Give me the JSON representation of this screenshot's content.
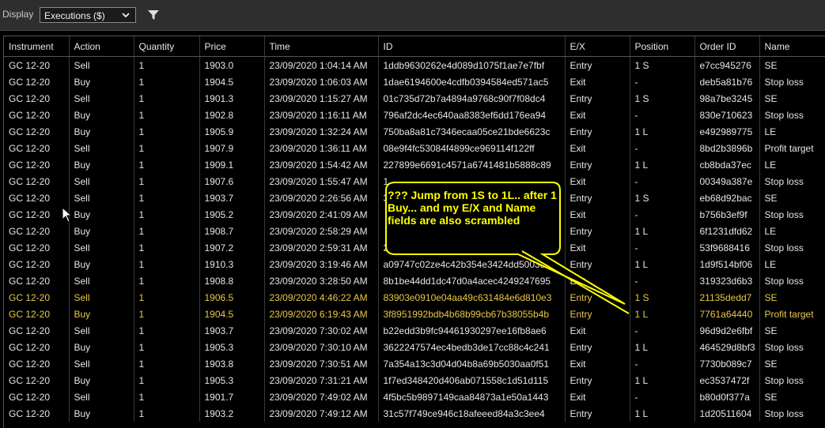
{
  "toolbar": {
    "display_label": "Display",
    "dropdown_value": "Executions ($)",
    "filter_icon": "filter-icon"
  },
  "columns": [
    "Instrument",
    "Action",
    "Quantity",
    "Price",
    "Time",
    "ID",
    "E/X",
    "Position",
    "Order ID",
    "Name"
  ],
  "rows": [
    [
      "GC 12-20",
      "Sell",
      "1",
      "1903.0",
      "23/09/2020 1:04:14 AM",
      "1ddb9630262e4d089d1075f1ae7e7fbf",
      "Entry",
      "1 S",
      "e7cc945276",
      "SE"
    ],
    [
      "GC 12-20",
      "Buy",
      "1",
      "1904.5",
      "23/09/2020 1:06:03 AM",
      "1dae6194600e4cdfb0394584ed571ac5",
      "Exit",
      "-",
      "deb5a81b76",
      "Stop loss"
    ],
    [
      "GC 12-20",
      "Sell",
      "1",
      "1901.3",
      "23/09/2020 1:15:27 AM",
      "01c735d72b7a4894a9768c90f7f08dc4",
      "Entry",
      "1 S",
      "98a7be3245",
      "SE"
    ],
    [
      "GC 12-20",
      "Buy",
      "1",
      "1902.8",
      "23/09/2020 1:16:11 AM",
      "796af2dc4ec640aa8383ef6dd176ea94",
      "Exit",
      "-",
      "830e710623",
      "Stop loss"
    ],
    [
      "GC 12-20",
      "Buy",
      "1",
      "1905.9",
      "23/09/2020 1:32:24 AM",
      "750ba8a81c7346ecaa05ce21bde6623c",
      "Entry",
      "1 L",
      "e492989775",
      "LE"
    ],
    [
      "GC 12-20",
      "Sell",
      "1",
      "1907.9",
      "23/09/2020 1:36:11 AM",
      "08e9f4fc53084f4899ce969114f122ff",
      "Exit",
      "-",
      "8bd2b3896b",
      "Profit target"
    ],
    [
      "GC 12-20",
      "Buy",
      "1",
      "1909.1",
      "23/09/2020 1:54:42 AM",
      "227899e6691c4571a6741481b5888c89",
      "Entry",
      "1 L",
      "cb8bda37ec",
      "LE"
    ],
    [
      "GC 12-20",
      "Sell",
      "1",
      "1907.6",
      "23/09/2020 1:55:47 AM",
      "1",
      "Exit",
      "-",
      "00349a387e",
      "Stop loss"
    ],
    [
      "GC 12-20",
      "Sell",
      "1",
      "1903.7",
      "23/09/2020 2:26:56 AM",
      "3",
      "Entry",
      "1 S",
      "eb68d92bac",
      "SE"
    ],
    [
      "GC 12-20",
      "Buy",
      "1",
      "1905.2",
      "23/09/2020 2:41:09 AM",
      "",
      "Exit",
      "-",
      "b756b3ef9f",
      "Stop loss"
    ],
    [
      "GC 12-20",
      "Buy",
      "1",
      "1908.7",
      "23/09/2020 2:58:29 AM",
      "",
      "Entry",
      "1 L",
      "6f1231dfd62",
      "LE"
    ],
    [
      "GC 12-20",
      "Sell",
      "1",
      "1907.2",
      "23/09/2020 2:59:31 AM",
      "2",
      "Exit",
      "-",
      "53f9688416",
      "Stop loss"
    ],
    [
      "GC 12-20",
      "Buy",
      "1",
      "1910.3",
      "23/09/2020 3:19:46 AM",
      "a09747c02ze4c42b354e3424dd5003d",
      "Entry",
      "1 L",
      "1d9f514bf06",
      "LE"
    ],
    [
      "GC 12-20",
      "Sell",
      "1",
      "1908.8",
      "23/09/2020 3:28:50 AM",
      "8b1be44dd1dc47d0a4acec4249247695",
      "Exit",
      "-",
      "319323d6b3",
      "Stop loss"
    ],
    [
      "GC 12-20",
      "Sell",
      "1",
      "1906.5",
      "23/09/2020 4:46:22 AM",
      "83903e0910e04aa49c631484e6d810e3",
      "Entry",
      "1 S",
      "21135dedd7",
      "SE"
    ],
    [
      "GC 12-20",
      "Buy",
      "1",
      "1904.5",
      "23/09/2020 6:19:43 AM",
      "3f8951992bdb4b68b99cb67b38055b4b",
      "Entry",
      "1 L",
      "7761a64440",
      "Profit target"
    ],
    [
      "GC 12-20",
      "Sell",
      "1",
      "1903.7",
      "23/09/2020 7:30:02 AM",
      "b22edd3b9fc94461930297ee16fb8ae6",
      "Exit",
      "-",
      "96d9d2e6fbf",
      "SE"
    ],
    [
      "GC 12-20",
      "Buy",
      "1",
      "1905.3",
      "23/09/2020 7:30:10 AM",
      "3622247574ec4bedb3de17cc88c4c241",
      "Entry",
      "1 L",
      "464529d8bf3",
      "Stop loss"
    ],
    [
      "GC 12-20",
      "Sell",
      "1",
      "1903.8",
      "23/09/2020 7:30:51 AM",
      "7a354a13c3d04d04b8a69b5030aa0f51",
      "Exit",
      "-",
      "7730b089c7",
      "SE"
    ],
    [
      "GC 12-20",
      "Buy",
      "1",
      "1905.3",
      "23/09/2020 7:31:21 AM",
      "1f7ed348420d406ab071558c1d51d115",
      "Entry",
      "1 L",
      "ec3537472f",
      "Stop loss"
    ],
    [
      "GC 12-20",
      "Sell",
      "1",
      "1901.7",
      "23/09/2020 7:49:02 AM",
      "4f5bc5b9897149caa84873a1e50a1443",
      "Exit",
      "-",
      "b80d0f377a",
      "SE"
    ],
    [
      "GC 12-20",
      "Buy",
      "1",
      "1903.2",
      "23/09/2020 7:49:12 AM",
      "31c57f749ce946c18afeeed84a3c3ee4",
      "Entry",
      "1 L",
      "1d20511604",
      "Stop loss"
    ]
  ],
  "highlighted_rows": [
    14,
    15
  ],
  "callout": {
    "text": "??? Jump from 1S to 1L.. after 1 Buy... and my E/X and Name fields are also scrambled",
    "color": "#ffff00"
  },
  "colors": {
    "highlight_text": "#e8c94a",
    "background": "#000000"
  }
}
